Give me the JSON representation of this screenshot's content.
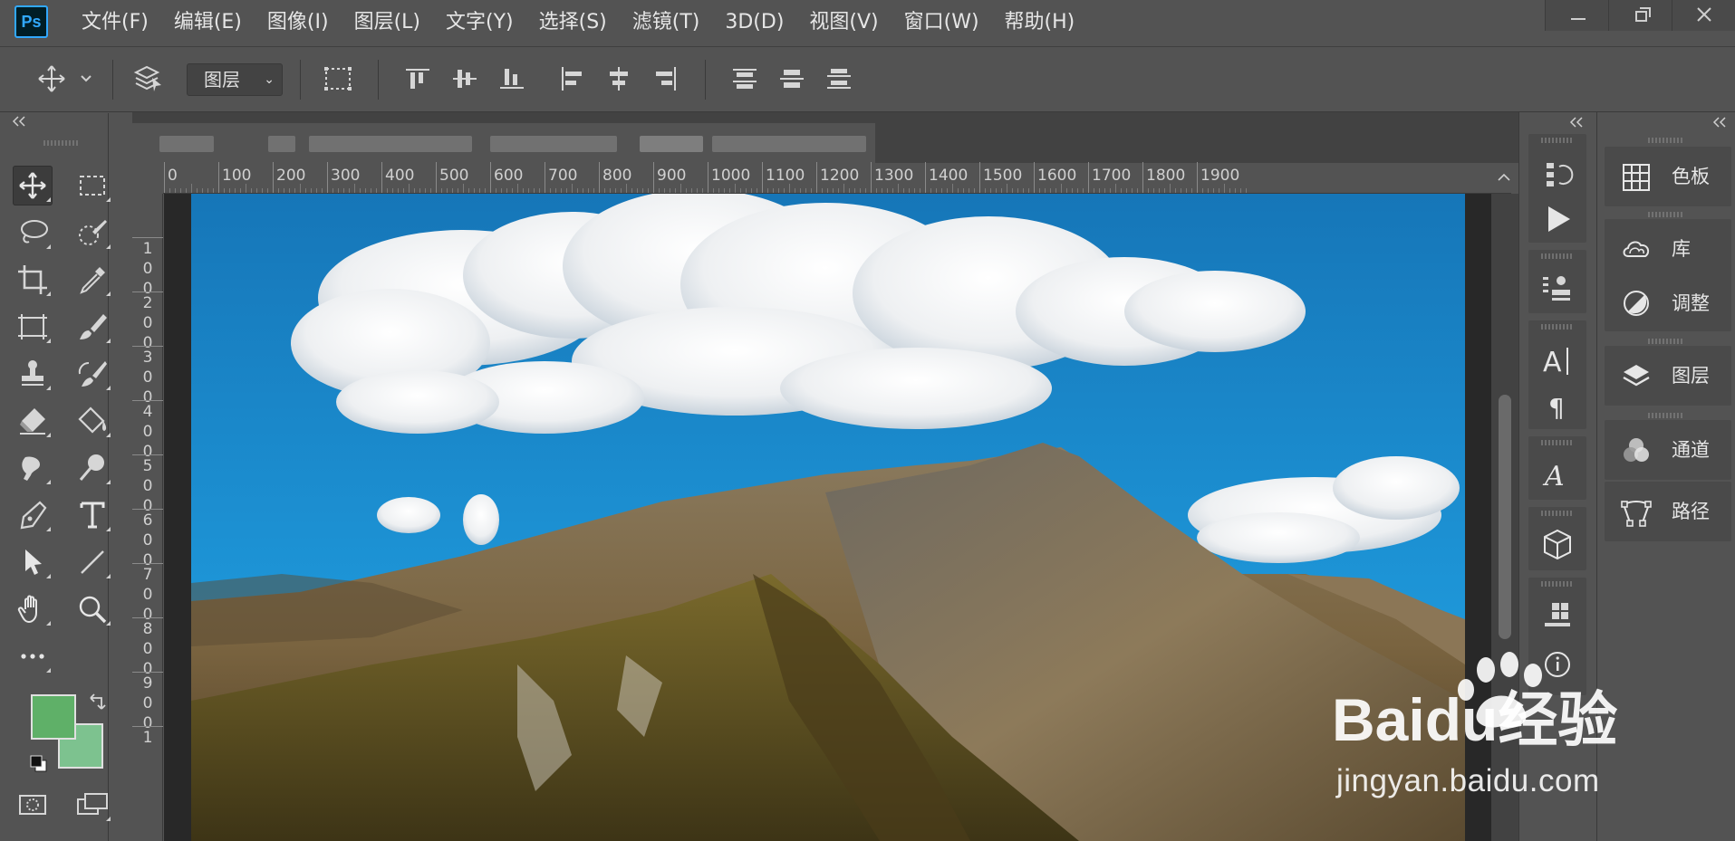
{
  "app": {
    "logo_text": "Ps",
    "accent_color": "#31a8ff"
  },
  "menu": {
    "items": [
      "文件(F)",
      "编辑(E)",
      "图像(I)",
      "图层(L)",
      "文字(Y)",
      "选择(S)",
      "滤镜(T)",
      "3D(D)",
      "视图(V)",
      "窗口(W)",
      "帮助(H)"
    ]
  },
  "options_bar": {
    "auto_select_target": "图层"
  },
  "rulers": {
    "horizontal": [
      "0",
      "100",
      "200",
      "300",
      "400",
      "500",
      "600",
      "700",
      "800",
      "900",
      "1000",
      "1100",
      "1200",
      "1300",
      "1400",
      "1500",
      "1600",
      "1700",
      "1800",
      "1900"
    ],
    "vertical": [
      "1\n0\n0",
      "2\n0\n0",
      "3\n0\n0",
      "4\n0\n0",
      "5\n0\n0",
      "6\n0\n0",
      "7\n0\n0",
      "8\n0\n0",
      "9\n0\n0",
      "1"
    ]
  },
  "toolbar": {
    "foreground_color": "#5fb068",
    "background_color": "#7dc28f",
    "tools": [
      "move-tool",
      "marquee-tool",
      "lasso-tool",
      "quick-selection-tool",
      "crop-tool",
      "eyedropper-tool",
      "frame-tool",
      "brush-tool",
      "stamp-tool",
      "history-brush-tool",
      "eraser-tool",
      "paint-bucket-tool",
      "smudge-tool",
      "dodge-tool",
      "pen-tool",
      "type-tool",
      "path-selection-tool",
      "line-tool",
      "hand-tool",
      "zoom-tool",
      "more-tools"
    ]
  },
  "panels": {
    "items": [
      {
        "label": "色板",
        "icon": "swatches-icon"
      },
      {
        "label": "库",
        "icon": "libraries-icon"
      },
      {
        "label": "调整",
        "icon": "adjustments-icon"
      },
      {
        "label": "图层",
        "icon": "layers-icon"
      },
      {
        "label": "通道",
        "icon": "channels-icon"
      },
      {
        "label": "路径",
        "icon": "paths-icon"
      }
    ]
  },
  "watermark": {
    "brand": "Baidu经验",
    "url": "jingyan.baidu.com"
  }
}
